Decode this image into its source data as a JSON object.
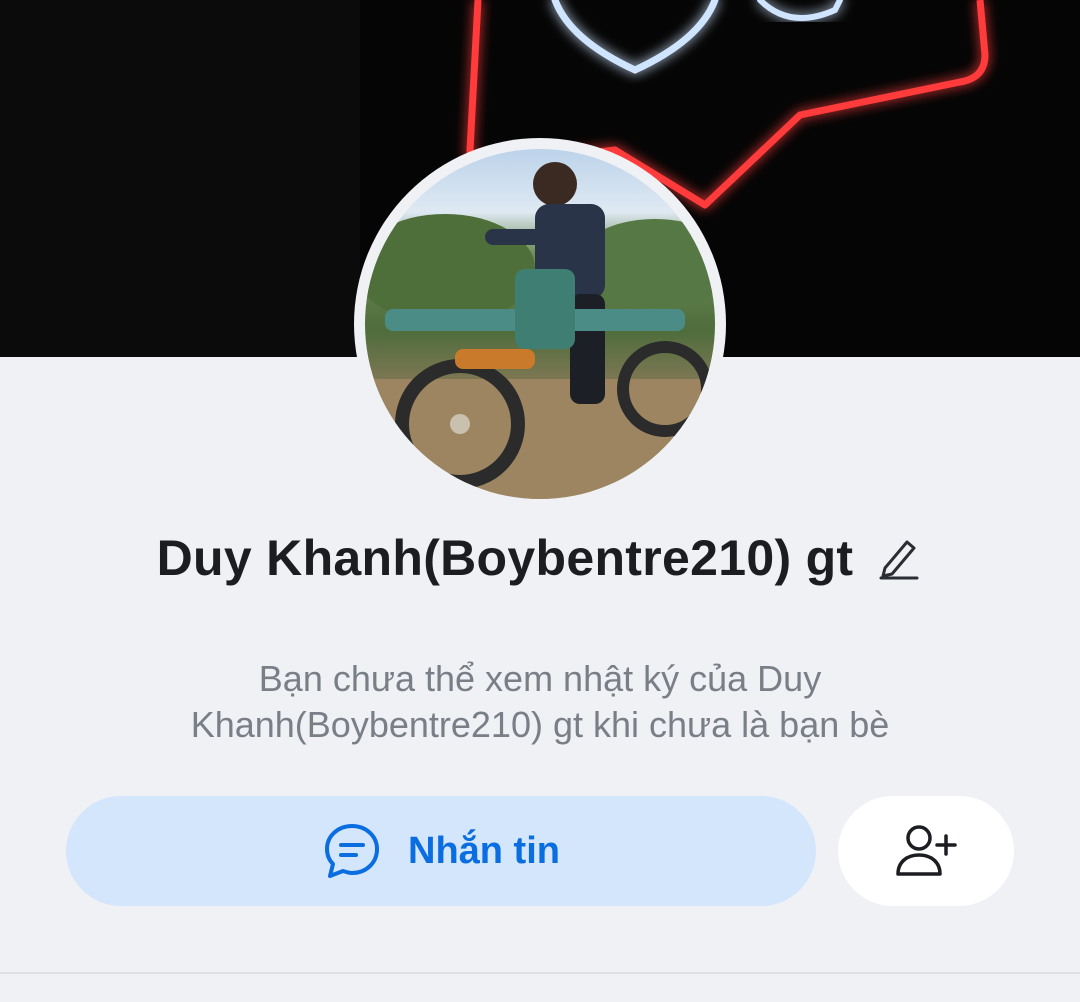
{
  "profile": {
    "name": "Duy Khanh(Boybentre210) gt",
    "notice": "Bạn chưa thể xem nhật ký của Duy Khanh(Boybentre210) gt khi chưa là bạn bè"
  },
  "actions": {
    "message_label": "Nhắn tin",
    "message_icon": "chat-bubble-icon",
    "add_friend_icon": "add-friend-icon",
    "edit_icon": "pencil-icon"
  },
  "colors": {
    "accent": "#0a6de0",
    "message_button_bg": "#d4e6fc",
    "page_bg": "#eff1f5"
  }
}
